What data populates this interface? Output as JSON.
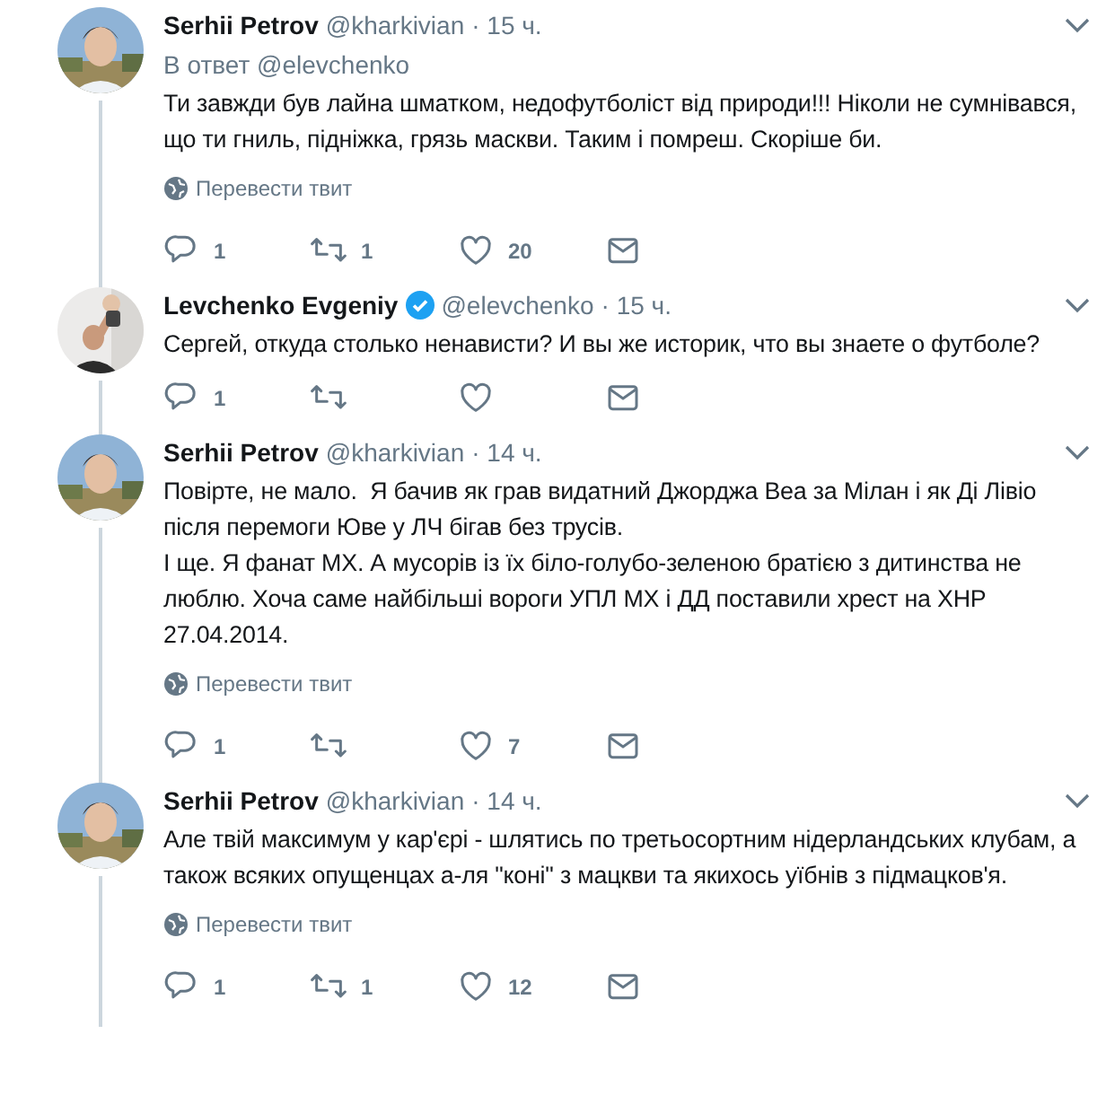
{
  "tweets": [
    {
      "name": "Serhii Petrov",
      "handle": "@kharkivian",
      "time": "· 15 ч.",
      "reply_to": "В ответ @elevchenko",
      "text": "Ти завжди був лайна шматком, недофутболіст від природи!!! Ніколи не сумнівався, що ти гниль, підніжка, грязь маскви. Таким і помреш. Скоріше би.",
      "translate": "Перевести твит",
      "replies": "1",
      "retweets": "1",
      "likes": "20"
    },
    {
      "name": "Levchenko Evgeniy",
      "verified": true,
      "handle": "@elevchenko",
      "time": "· 15 ч.",
      "text": "Сергей, откуда столько ненависти? И вы же историк, что вы знаете о футболе?",
      "replies": "1"
    },
    {
      "name": "Serhii Petrov",
      "handle": "@kharkivian",
      "time": "· 14 ч.",
      "text": "Повірте, не мало.  Я бачив як грав видатний Джорджа Веа за Мілан і як Ді Лівіо після перемоги Юве у ЛЧ бігав без трусів.\nІ ще. Я фанат МХ. А мусорів із їх біло-голубо-зеленою братією з дитинства не люблю. Хоча саме найбільші вороги УПЛ МХ і ДД поставили хрест на ХНР 27.04.2014.",
      "translate": "Перевести твит",
      "replies": "1",
      "likes": "7"
    },
    {
      "name": "Serhii Petrov",
      "handle": "@kharkivian",
      "time": "· 14 ч.",
      "text": "Але твій максимум у кар'єрі - шлятись по третьосортним нідерландських клубам, а також всяких опущенцах а-ля \"коні\" з мацкви та якихось уїбнів з підмацков'я.",
      "translate": "Перевести твит",
      "replies": "1",
      "retweets": "1",
      "likes": "12"
    }
  ]
}
